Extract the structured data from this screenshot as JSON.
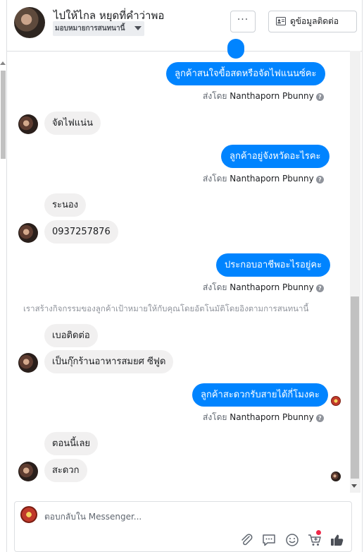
{
  "header": {
    "title": "ไปให้ไกล หยุดที่คำว่าพอ",
    "assign_label": "มอบหมายการสนทนานี้",
    "more_label": "···",
    "contact_label": "ดูข้อมูลติดต่อ"
  },
  "chat": {
    "sent_prefix": "ส่งโดย",
    "sender_name": "Nanthaporn Pbunny",
    "messages": [
      {
        "text": "ลูกค้าสนใจขื้อสดหรือจัดไฟแนนซ์คะ"
      },
      {
        "text": "จัดไฟแน่น"
      },
      {
        "text": "ลูกค้าอยู่จังหวัดอะไรคะ"
      },
      {
        "text": "ระนอง"
      },
      {
        "text": "0937257876"
      },
      {
        "text": "ประกอบอาชีพอะไรอยู่คะ"
      },
      {
        "text": "เบอติดต่อ"
      },
      {
        "text": "เป็นกุ๊กร้านอาหารสมยศ ซีฟูด"
      },
      {
        "text": "ลูกค้าสะดวกรับสายได้กี่โมงคะ"
      },
      {
        "text": "ตอนนี้เลย"
      },
      {
        "text": "สะดวก"
      }
    ],
    "system_note": "เราสร้างกิจกรรมของลูกค้าเป้าหมายให้กับคุณโดยอัตโนมัติโดยอิงตามการสนทนานี้"
  },
  "composer": {
    "placeholder": "ตอบกลับใน Messenger..."
  },
  "colors": {
    "accent": "#0084ff",
    "incoming_bubble": "#f1f0f0",
    "notification": "#f02849"
  },
  "icons": [
    "more-icon",
    "contact-card-icon",
    "caret-down-icon",
    "info-icon",
    "attachment-icon",
    "saved-reply-icon",
    "emoji-icon",
    "cart-icon",
    "like-icon"
  ]
}
